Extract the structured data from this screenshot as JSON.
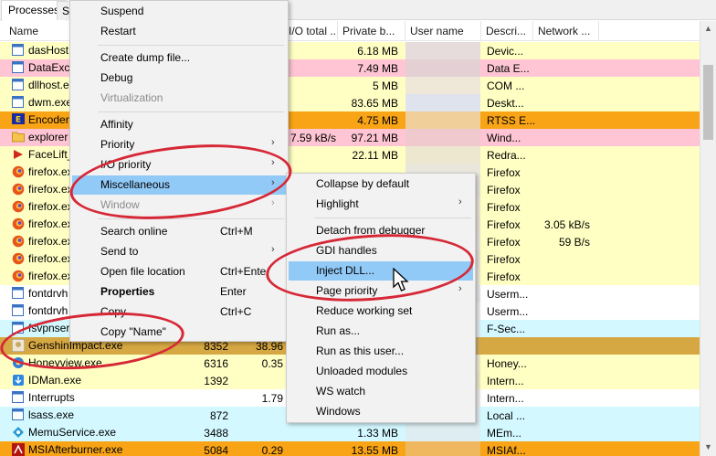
{
  "tabs": [
    "Processes",
    "S"
  ],
  "columns": {
    "name": "Name",
    "io_total": "I/O total ...",
    "private_bytes": "Private b...",
    "user_name": "User name",
    "description": "Descri...",
    "network": "Network ..."
  },
  "colors": {
    "yellow": "#ffffc4",
    "pink": "#ffc5d5",
    "orange": "#f8a416",
    "cyan": "#d3f8ff",
    "golden": "#d6a843",
    "highlight": "#91c9f7",
    "annotation": "#d62836"
  },
  "processes": [
    {
      "name": "dasHost",
      "icon": "window-icon",
      "bg": "yellow",
      "cpu": "",
      "pid": "",
      "io": "",
      "private": "6.18 MB",
      "desc": "Devic...",
      "net": ""
    },
    {
      "name": "DataExch",
      "icon": "window-icon",
      "bg": "pink",
      "cpu": "",
      "pid": "",
      "io": "",
      "private": "7.49 MB",
      "desc": "Data E...",
      "net": ""
    },
    {
      "name": "dllhost.e",
      "icon": "window-icon",
      "bg": "yellow",
      "cpu": "",
      "pid": "",
      "io": "",
      "private": "5 MB",
      "desc": "COM ...",
      "net": ""
    },
    {
      "name": "dwm.exe",
      "icon": "window-icon",
      "bg": "yellow",
      "cpu": "",
      "pid": "",
      "io": "",
      "private": "83.65 MB",
      "desc": "Deskt...",
      "net": ""
    },
    {
      "name": "Encoder",
      "icon": "encoder-icon",
      "bg": "orange",
      "cpu": "",
      "pid": "",
      "io": "",
      "private": "4.75 MB",
      "desc": "RTSS E...",
      "net": ""
    },
    {
      "name": "explorer",
      "icon": "folder-icon",
      "bg": "pink",
      "cpu": "",
      "pid": "",
      "io": "7.59 kB/s",
      "private": "97.21 MB",
      "desc": "Wind...",
      "net": ""
    },
    {
      "name": "FaceLift_",
      "icon": "facelift-icon",
      "bg": "yellow",
      "cpu": "",
      "pid": "",
      "io": "",
      "private": "22.11 MB",
      "desc": "Redra...",
      "net": ""
    },
    {
      "name": "firefox.ex",
      "icon": "firefox-icon",
      "bg": "yellow",
      "cpu": "",
      "pid": "",
      "io": "",
      "private": "",
      "desc": "Firefox",
      "net": ""
    },
    {
      "name": "firefox.ex",
      "icon": "firefox-icon",
      "bg": "yellow",
      "cpu": "",
      "pid": "",
      "io": "",
      "private": "",
      "desc": "Firefox",
      "net": ""
    },
    {
      "name": "firefox.ex",
      "icon": "firefox-icon",
      "bg": "yellow",
      "cpu": "",
      "pid": "",
      "io": "",
      "private": "",
      "desc": "Firefox",
      "net": ""
    },
    {
      "name": "firefox.ex",
      "icon": "firefox-icon",
      "bg": "yellow",
      "cpu": "",
      "pid": "",
      "io": "",
      "private": "",
      "desc": "Firefox",
      "net": "3.05 kB/s"
    },
    {
      "name": "firefox.ex",
      "icon": "firefox-icon",
      "bg": "yellow",
      "cpu": "",
      "pid": "",
      "io": "",
      "private": "",
      "desc": "Firefox",
      "net": "59 B/s"
    },
    {
      "name": "firefox.ex",
      "icon": "firefox-icon",
      "bg": "yellow",
      "cpu": "",
      "pid": "",
      "io": "",
      "private": "",
      "desc": "Firefox",
      "net": ""
    },
    {
      "name": "firefox.ex",
      "icon": "firefox-icon",
      "bg": "yellow",
      "cpu": "",
      "pid": "",
      "io": "",
      "private": "",
      "desc": "Firefox",
      "net": ""
    },
    {
      "name": "fontdrvh",
      "icon": "window-icon",
      "bg": "white",
      "cpu": "",
      "pid": "",
      "io": "",
      "private": "",
      "desc": "Userm...",
      "net": ""
    },
    {
      "name": "fontdrvh",
      "icon": "window-icon",
      "bg": "white",
      "cpu": "",
      "pid": "",
      "io": "",
      "private": "",
      "desc": "Userm...",
      "net": ""
    },
    {
      "name": "fsvpnser",
      "icon": "window-icon",
      "bg": "cyan",
      "cpu": "",
      "pid": "",
      "io": "",
      "private": "",
      "desc": "F-Sec...",
      "net": ""
    },
    {
      "name": "GenshinImpact.exe",
      "icon": "genshin-icon",
      "bg": "golden",
      "cpu": "",
      "pid": "8352",
      "io": "38.96",
      "private": "",
      "desc": "",
      "net": ""
    },
    {
      "name": "Honeyview.exe",
      "icon": "honeyview-icon",
      "bg": "yellow",
      "cpu": "",
      "pid": "6316",
      "io": "0.35",
      "private": "",
      "desc": "Honey...",
      "net": ""
    },
    {
      "name": "IDMan.exe",
      "icon": "idman-icon",
      "bg": "yellow",
      "cpu": "",
      "pid": "1392",
      "io": "",
      "private": "",
      "desc": "Intern...",
      "net": ""
    },
    {
      "name": "Interrupts",
      "icon": "window-icon",
      "bg": "white",
      "cpu": "",
      "pid": "",
      "io": "1.79",
      "private": "",
      "desc": "Intern...",
      "net": ""
    },
    {
      "name": "lsass.exe",
      "icon": "window-icon",
      "bg": "cyan",
      "cpu": "",
      "pid": "872",
      "io": "",
      "private": "",
      "desc": "Local ...",
      "net": ""
    },
    {
      "name": "MemuService.exe",
      "icon": "memu-icon",
      "bg": "cyan",
      "cpu": "",
      "pid": "3488",
      "io": "",
      "private": "1.33 MB",
      "desc": "MEm...",
      "net": ""
    },
    {
      "name": "MSIAfterburner.exe",
      "icon": "msi-icon",
      "bg": "orange",
      "cpu": "",
      "pid": "5084",
      "io": "0.29",
      "private": "13.55 MB",
      "desc": "MSIAf...",
      "net": ""
    }
  ],
  "menu1": {
    "items": [
      {
        "label": "Suspend",
        "shortcut": "",
        "arrow": false,
        "state": "normal"
      },
      {
        "label": "Restart",
        "shortcut": "",
        "arrow": false,
        "state": "normal"
      },
      {
        "sep": true
      },
      {
        "label": "Create dump file...",
        "shortcut": "",
        "arrow": false,
        "state": "normal"
      },
      {
        "label": "Debug",
        "shortcut": "",
        "arrow": false,
        "state": "normal"
      },
      {
        "label": "Virtualization",
        "shortcut": "",
        "arrow": false,
        "state": "disabled"
      },
      {
        "sep": true
      },
      {
        "label": "Affinity",
        "shortcut": "",
        "arrow": false,
        "state": "normal"
      },
      {
        "label": "Priority",
        "shortcut": "",
        "arrow": true,
        "state": "normal"
      },
      {
        "label": "I/O priority",
        "shortcut": "",
        "arrow": true,
        "state": "normal"
      },
      {
        "label": "Miscellaneous",
        "shortcut": "",
        "arrow": true,
        "state": "highlighted"
      },
      {
        "label": "Window",
        "shortcut": "",
        "arrow": true,
        "state": "disabled"
      },
      {
        "sep": true
      },
      {
        "label": "Search online",
        "shortcut": "Ctrl+M",
        "arrow": false,
        "state": "normal"
      },
      {
        "label": "Send to",
        "shortcut": "",
        "arrow": true,
        "state": "normal"
      },
      {
        "label": "Open file location",
        "shortcut": "Ctrl+Ente",
        "arrow": false,
        "state": "normal"
      },
      {
        "label": "Properties",
        "shortcut": "Enter",
        "arrow": false,
        "state": "bold"
      },
      {
        "label": "Copy",
        "shortcut": "Ctrl+C",
        "arrow": false,
        "state": "normal"
      },
      {
        "label": "Copy \"Name\"",
        "shortcut": "",
        "arrow": false,
        "state": "normal"
      }
    ]
  },
  "menu2": {
    "items": [
      {
        "label": "Collapse by default",
        "arrow": false,
        "state": "normal"
      },
      {
        "label": "Highlight",
        "arrow": true,
        "state": "normal"
      },
      {
        "sep": true
      },
      {
        "label": "Detach from debugger",
        "arrow": false,
        "state": "normal"
      },
      {
        "label": "GDI handles",
        "arrow": false,
        "state": "normal"
      },
      {
        "label": "Inject DLL...",
        "arrow": false,
        "state": "highlighted"
      },
      {
        "label": "Page priority",
        "arrow": true,
        "state": "normal"
      },
      {
        "label": "Reduce working set",
        "arrow": false,
        "state": "normal"
      },
      {
        "label": "Run as...",
        "arrow": false,
        "state": "normal"
      },
      {
        "label": "Run as this user...",
        "arrow": false,
        "state": "normal"
      },
      {
        "label": "Unloaded modules",
        "arrow": false,
        "state": "normal"
      },
      {
        "label": "WS watch",
        "arrow": false,
        "state": "normal"
      },
      {
        "label": "Windows",
        "arrow": false,
        "state": "normal"
      }
    ]
  }
}
